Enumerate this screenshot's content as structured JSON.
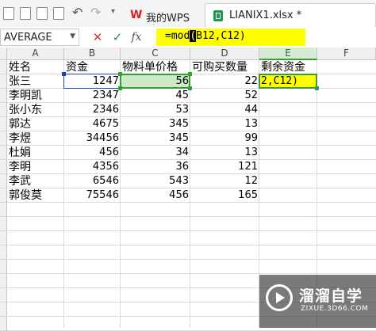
{
  "toolbar": {
    "icons": [
      "new-file-icon",
      "pdf-icon",
      "print-preview-icon",
      "print-icon",
      "undo-icon",
      "redo-icon",
      "more-icon"
    ]
  },
  "tabs": [
    {
      "label": "我的WPS"
    },
    {
      "label": "LIANIX1.xlsx *"
    }
  ],
  "formula_bar": {
    "name_box": "AVERAGE",
    "formula_prefix": "=mod",
    "formula_paren": "(",
    "formula_suffix": "B12,C12)"
  },
  "columns": [
    "A",
    "B",
    "C",
    "D",
    "E",
    "F"
  ],
  "rows": [
    {
      "A": "姓名",
      "B": "资金",
      "C": "物料单价格",
      "D": "可购买数量",
      "E": "剩余资金"
    },
    {
      "A": "张三",
      "B": "1247",
      "C": "56",
      "D": "22",
      "E": "2,C12)"
    },
    {
      "A": "李明凯",
      "B": "2347",
      "C": "45",
      "D": "52",
      "E": ""
    },
    {
      "A": "张小东",
      "B": "2346",
      "C": "53",
      "D": "44",
      "E": ""
    },
    {
      "A": "郭达",
      "B": "4675",
      "C": "345",
      "D": "13",
      "E": ""
    },
    {
      "A": "李煜",
      "B": "34456",
      "C": "345",
      "D": "99",
      "E": ""
    },
    {
      "A": "杜娟",
      "B": "456",
      "C": "34",
      "D": "13",
      "E": ""
    },
    {
      "A": "李明",
      "B": "4356",
      "C": "36",
      "D": "121",
      "E": ""
    },
    {
      "A": "李武",
      "B": "6546",
      "C": "543",
      "D": "12",
      "E": ""
    },
    {
      "A": "郭俊莫",
      "B": "75546",
      "C": "456",
      "D": "165",
      "E": ""
    }
  ],
  "watermark": {
    "title": "溜溜自学",
    "url": "ZIXUE.3D66.COM"
  }
}
